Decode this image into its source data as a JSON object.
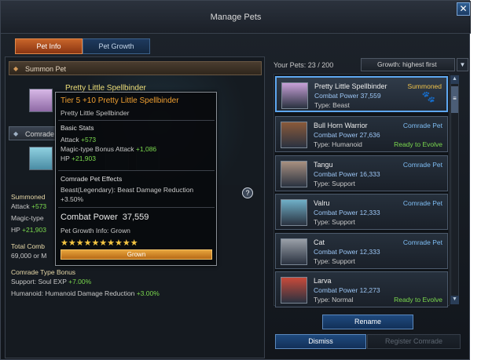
{
  "window": {
    "title": "Manage Pets",
    "close_glyph": "✕"
  },
  "tabs": [
    {
      "label": "Pet Info",
      "active": true
    },
    {
      "label": "Pet Growth",
      "active": false
    }
  ],
  "left": {
    "summon_header": "Summon Pet",
    "behind_name": "Pretty Little Spellbinder",
    "comrade_header": "Comrade",
    "stats": {
      "summoned_label": "Summoned",
      "attack_label": "Attack",
      "attack_value": "+573",
      "magic_label": "Magic-type",
      "hp_label": "HP",
      "hp_value": "+21,903",
      "total_label": "Total Comb",
      "total_value": "69,000 or M",
      "bonus_header": "Comrade Type Bonus",
      "bonus_support_label": "Support: Soul EXP",
      "bonus_support_value": "+7.00%",
      "bonus_humanoid_label": "Humanoid: Humanoid Damage Reduction",
      "bonus_humanoid_value": "+3.00%"
    },
    "help_glyph": "?"
  },
  "tooltip": {
    "title": "Tier 5 +10 Pretty Little Spellbinder",
    "subtitle": "Pretty Little Spellbinder",
    "basic_stats_header": "Basic Stats",
    "attack_label": "Attack",
    "attack_value": "+573",
    "magic_label": "Magic-type Bonus Attack",
    "magic_value": "+1,086",
    "hp_label": "HP",
    "hp_value": "+21,903",
    "effects_header": "Comrade Pet Effects",
    "effect_label": "Beast(Legendary): Beast Damage Reduction",
    "effect_value": "+3.50%",
    "cp_label": "Combat Power",
    "cp_value": "37,559",
    "growth_info": "Pet Growth Info: Grown",
    "stars": "★★★★★★★★★★",
    "star_count": 10,
    "grown_bar_label": "Grown"
  },
  "right": {
    "your_pets": "Your Pets: 23 / 200",
    "sort_selected": "Growth: highest first",
    "caret": "▼",
    "scroll_up": "▲",
    "scroll_down": "▼",
    "scroll_thumb": "≡",
    "pets": [
      {
        "name": "Pretty Little Spellbinder",
        "cp": "Combat Power 37,559",
        "type": "Type: Beast",
        "status": "Summoned",
        "status_kind": "summ",
        "extra": "",
        "selected": true,
        "color": "#c8a0d8"
      },
      {
        "name": "Bull Horn Warrior",
        "cp": "Combat Power 27,636",
        "type": "Type: Humanoid",
        "status": "Comrade Pet",
        "status_kind": "comr",
        "extra": "Ready to Evolve",
        "selected": false,
        "color": "#8a5a3a"
      },
      {
        "name": "Tangu",
        "cp": "Combat Power 16,333",
        "type": "Type: Support",
        "status": "Comrade Pet",
        "status_kind": "comr",
        "extra": "",
        "selected": false,
        "color": "#a89080"
      },
      {
        "name": "Valru",
        "cp": "Combat Power 12,333",
        "type": "Type: Support",
        "status": "Comrade Pet",
        "status_kind": "comr",
        "extra": "",
        "selected": false,
        "color": "#6fb0c8"
      },
      {
        "name": "Cat",
        "cp": "Combat Power 12,333",
        "type": "Type: Support",
        "status": "Comrade Pet",
        "status_kind": "comr",
        "extra": "",
        "selected": false,
        "color": "#9aa0a8"
      },
      {
        "name": "Larva",
        "cp": "Combat Power 12,273",
        "type": "Type: Normal",
        "status": "",
        "status_kind": "",
        "extra": "Ready to Evolve",
        "selected": false,
        "color": "#c84a3a"
      }
    ]
  },
  "buttons": {
    "rename": "Rename",
    "dismiss": "Dismiss",
    "register": "Register Comrade"
  }
}
